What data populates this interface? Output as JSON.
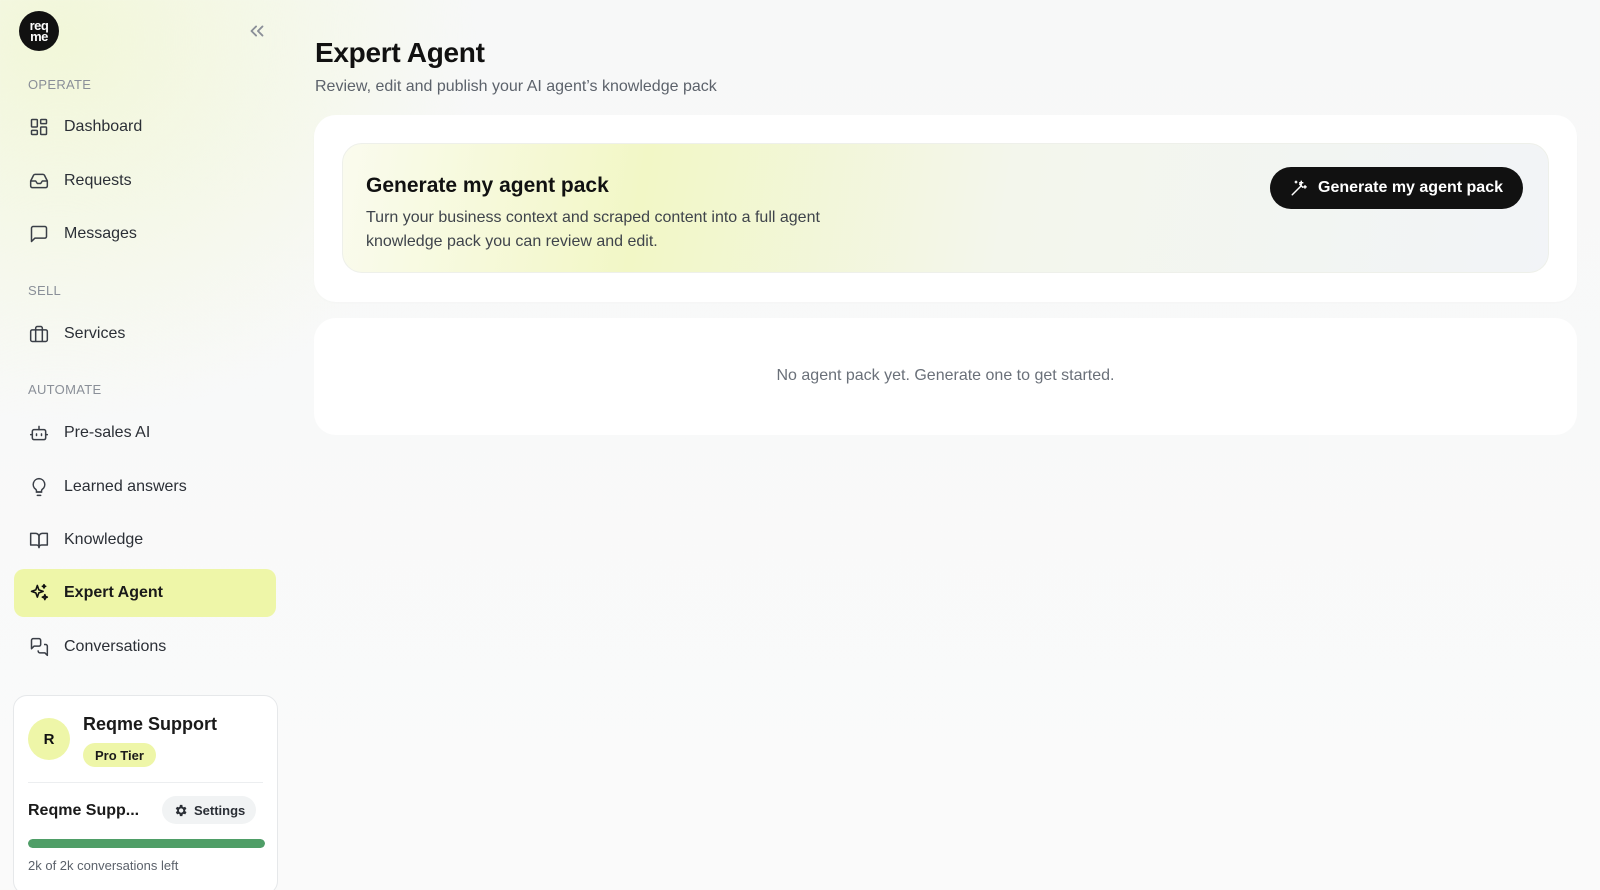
{
  "brand": {
    "logo_line1": "req",
    "logo_line2": "me"
  },
  "sidebar": {
    "sections": [
      {
        "label": "OPERATE"
      },
      {
        "label": "SELL"
      },
      {
        "label": "AUTOMATE"
      }
    ],
    "items": [
      {
        "label": "Dashboard",
        "icon": "grid-icon"
      },
      {
        "label": "Requests",
        "icon": "inbox-icon"
      },
      {
        "label": "Messages",
        "icon": "message-icon"
      },
      {
        "label": "Services",
        "icon": "briefcase-icon"
      },
      {
        "label": "Pre-sales AI",
        "icon": "bot-icon"
      },
      {
        "label": "Learned answers",
        "icon": "lightbulb-icon"
      },
      {
        "label": "Knowledge",
        "icon": "book-icon"
      },
      {
        "label": "Expert Agent",
        "icon": "sparkles-icon",
        "active": true
      },
      {
        "label": "Conversations",
        "icon": "chat-bubbles-icon"
      }
    ]
  },
  "account": {
    "avatar_initial": "R",
    "name": "Reqme Support",
    "tier": "Pro Tier",
    "workspace": "Reqme Supp...",
    "settings_label": "Settings",
    "usage_fraction": 1.0,
    "usage_text": "2k of 2k conversations left",
    "usage_color": "#4f9e67"
  },
  "page": {
    "title": "Expert Agent",
    "subtitle": "Review, edit and publish your AI agent’s knowledge pack"
  },
  "generate": {
    "title": "Generate my agent pack",
    "description": "Turn your business context and scraped content into a full agent knowledge pack you can review and edit.",
    "button_label": "Generate my agent pack"
  },
  "empty_state": {
    "text": "No agent pack yet. Generate one to get started."
  },
  "colors": {
    "accent": "#eef6a8",
    "primary_button": "#111111"
  }
}
